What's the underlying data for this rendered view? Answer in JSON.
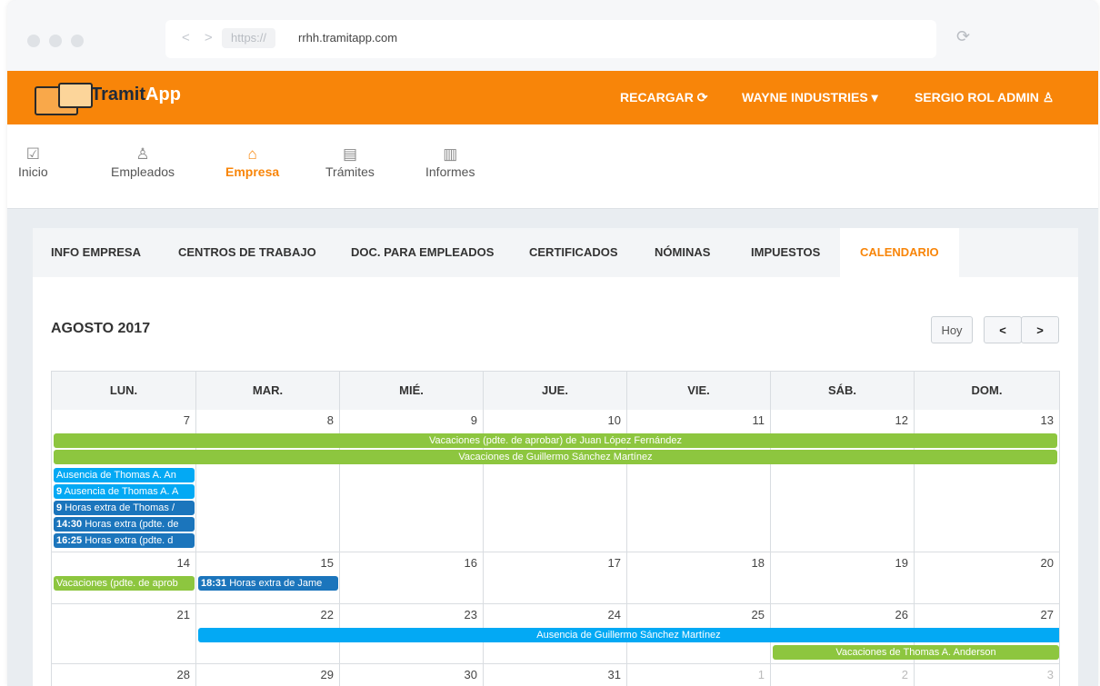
{
  "browser": {
    "protocol": "https://",
    "host": "rrhh.tramitapp.com",
    "nav_arrows": "< >",
    "reload_icon": "reload-icon"
  },
  "topbar": {
    "logo_text_1": "Tramit",
    "logo_text_2": "App",
    "reload": "RECARGAR",
    "reload_icon": "⟳",
    "company": "WAYNE INDUSTRIES",
    "company_caret": "▾",
    "user": "SERGIO ROL ADMIN",
    "user_icon": "♙",
    "color": "#f88509"
  },
  "mainnav": [
    {
      "label": "Inicio",
      "icon": "☑"
    },
    {
      "label": "Empleados",
      "icon": "♙"
    },
    {
      "label": "Empresa",
      "icon": "⌂"
    },
    {
      "label": "Trámites",
      "icon": "▤"
    },
    {
      "label": "Informes",
      "icon": "▥"
    }
  ],
  "tabs": [
    "INFO EMPRESA",
    "CENTROS DE TRABAJO",
    "DOC. PARA EMPLEADOS",
    "CERTIFICADOS",
    "NÓMINAS",
    "IMPUESTOS",
    "CALENDARIO"
  ],
  "calendar": {
    "month": "AGOSTO 2017",
    "today_label": "Hoy",
    "prev": "<",
    "next": ">",
    "weekdays": [
      "LUN.",
      "MAR.",
      "MIÉ.",
      "JUE.",
      "VIE.",
      "SÁB.",
      "DOM."
    ],
    "weeks": [
      [
        "7",
        "8",
        "9",
        "10",
        "11",
        "12",
        "13"
      ],
      [
        "14",
        "15",
        "16",
        "17",
        "18",
        "19",
        "20"
      ],
      [
        "21",
        "22",
        "23",
        "24",
        "25",
        "26",
        "27"
      ],
      [
        "28",
        "29",
        "30",
        "31",
        "1",
        "2",
        "3"
      ]
    ],
    "events": {
      "w1_vac_pending": "Vacaciones (pdte. de aprobar) de Juan López Fernández",
      "w1_vac_guillermo": "Vacaciones de Guillermo Sánchez Martínez",
      "w1_mon_1": "Ausencia de Thomas A. An",
      "w1_mon_2_time": "9",
      "w1_mon_2": "Ausencia de Thomas A. A",
      "w1_mon_3_time": "9",
      "w1_mon_3": "Horas extra de Thomas /",
      "w1_mon_4_time": "14:30",
      "w1_mon_4": "Horas extra (pdte. de",
      "w1_mon_5_time": "16:25",
      "w1_mon_5": "Horas extra (pdte. d",
      "w2_mon": "Vacaciones (pdte. de aprob",
      "w2_tue_time": "18:31",
      "w2_tue": "Horas extra de Jame",
      "w3_ausencia": "Ausencia de Guillermo Sánchez Martínez",
      "w3_vac_thomas": "Vacaciones de Thomas A. Anderson"
    },
    "colors": {
      "vacation": "#8dc63f",
      "absence": "#03a9f4",
      "overtime": "#1b75bc"
    }
  }
}
